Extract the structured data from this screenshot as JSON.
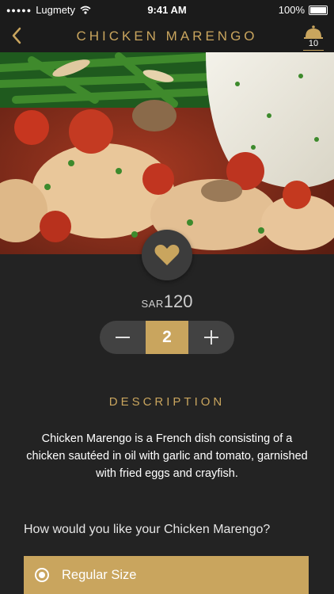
{
  "status_bar": {
    "carrier": "Lugmety",
    "signal_icon": "signal-dots-icon",
    "wifi_icon": "wifi-icon",
    "time": "9:41 AM",
    "battery": "100%",
    "battery_icon": "battery-icon"
  },
  "nav": {
    "back_icon": "chevron-left-icon",
    "title": "CHICKEN MARENGO",
    "cart_icon": "cloche-icon",
    "cart_count": "10"
  },
  "hero": {
    "image": "chicken-marengo-photo"
  },
  "favorite": {
    "icon": "heart-icon"
  },
  "price": {
    "currency": "SAR",
    "amount": "120"
  },
  "quantity": {
    "value": "2",
    "minus_icon": "minus-icon",
    "plus_icon": "plus-icon"
  },
  "description": {
    "heading": "DESCRIPTION",
    "text": "Chicken Marengo is a French dish consisting of a chicken sautéed in oil with garlic and tomato, garnished with fried eggs and crayfish."
  },
  "size": {
    "question": "How would you like your Chicken Marengo?",
    "options": [
      {
        "label": "Regular Size",
        "selected": true
      }
    ]
  },
  "colors": {
    "accent": "#c9a55e",
    "background": "#232323",
    "bar": "#1b1b1b",
    "button": "#424242"
  }
}
